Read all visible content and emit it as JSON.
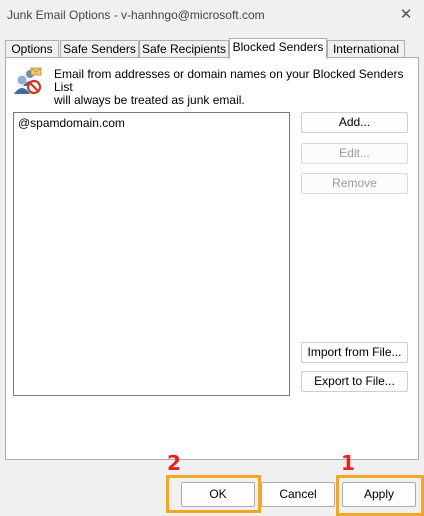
{
  "window": {
    "title": "Junk Email Options - v-hanhngo@microsoft.com",
    "close_glyph": "✕"
  },
  "tabs": [
    {
      "label": "Options",
      "active": false
    },
    {
      "label": "Safe Senders",
      "active": false
    },
    {
      "label": "Safe Recipients",
      "active": false
    },
    {
      "label": "Blocked Senders",
      "active": true
    },
    {
      "label": "International",
      "active": false
    }
  ],
  "info": {
    "icon": "blocked-senders-icon",
    "text_line1": "Email from addresses or domain names on your Blocked Senders List",
    "text_line2": "will always be treated as junk email."
  },
  "blocked_list": {
    "items": [
      "@spamdomain.com"
    ]
  },
  "side_buttons": {
    "add": "Add...",
    "edit": "Edit...",
    "remove": "Remove",
    "import": "Import from File...",
    "export": "Export to File..."
  },
  "footer_buttons": {
    "ok": "OK",
    "cancel": "Cancel",
    "apply": "Apply"
  },
  "annotations": {
    "step_ok": "2",
    "step_apply": "1",
    "highlight_color": "#f5a623",
    "number_color": "#e8211b"
  }
}
